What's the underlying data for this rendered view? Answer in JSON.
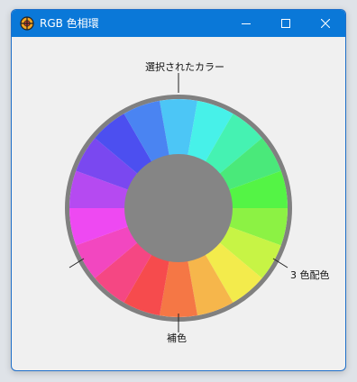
{
  "window": {
    "title": "RGB 色相環",
    "buttons": {
      "minimize": "minimize",
      "maximize": "maximize",
      "close": "close"
    }
  },
  "wheel": {
    "segment_colors": [
      "#4cc6f6",
      "#47f1e9",
      "#45f2b2",
      "#4ae97a",
      "#54f445",
      "#8cf244",
      "#c7f445",
      "#f3eb4c",
      "#f6b64b",
      "#f57745",
      "#f64b4d",
      "#f54783",
      "#f247c0",
      "#ee49f2",
      "#b54af1",
      "#7a48f0",
      "#4c4ff0",
      "#4a84f2"
    ],
    "rim_color": "#808080",
    "center_color": "#858585"
  },
  "labels": {
    "selected": "選択されたカラー",
    "complement": "補色",
    "triad": "3 色配色"
  }
}
